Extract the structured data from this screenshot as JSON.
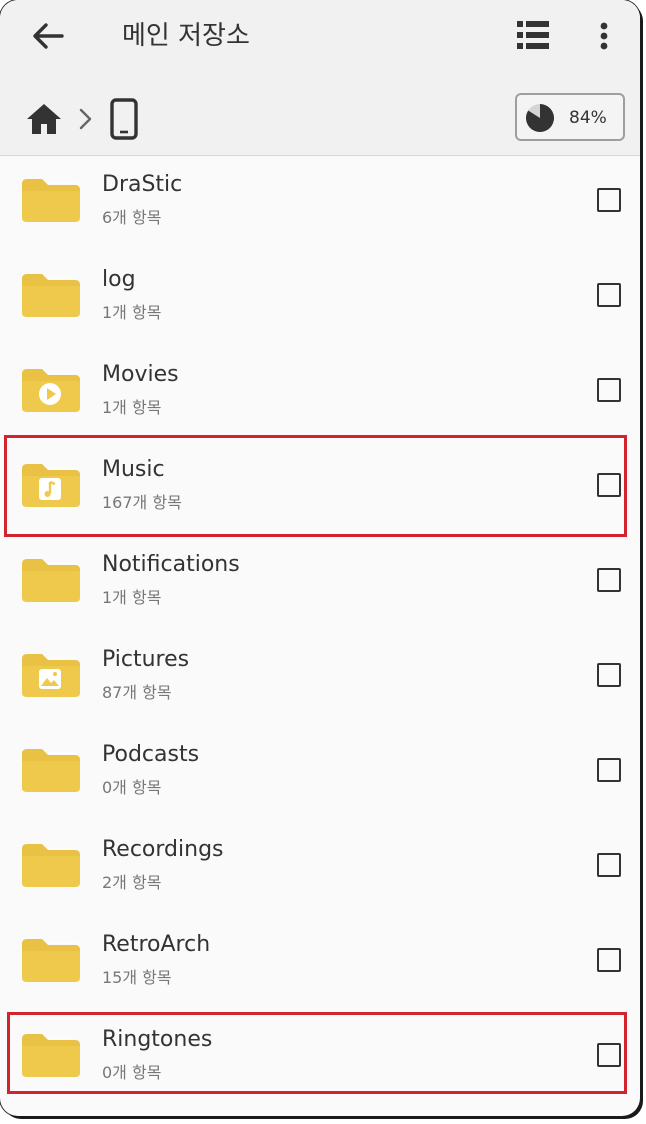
{
  "header": {
    "title": "메인 저장소",
    "back_icon": "arrow-left-icon",
    "view_icon": "list-view-icon",
    "more_icon": "more-vert-icon"
  },
  "breadcrumb": {
    "home_icon": "home-icon",
    "separator_icon": "chevron-right-icon",
    "device_icon": "phone-icon"
  },
  "storage": {
    "used_percent_label": "84%",
    "used_fraction": 0.84
  },
  "colors": {
    "folder": "#efc94c",
    "highlight": "#d3232c"
  },
  "folders": [
    {
      "name": "DraStic",
      "count": "6개 항목",
      "icon": "folder-icon"
    },
    {
      "name": "log",
      "count": "1개 항목",
      "icon": "folder-icon"
    },
    {
      "name": "Movies",
      "count": "1개 항목",
      "icon": "folder-video-icon"
    },
    {
      "name": "Music",
      "count": "167개 항목",
      "icon": "folder-music-icon"
    },
    {
      "name": "Notifications",
      "count": "1개 항목",
      "icon": "folder-icon"
    },
    {
      "name": "Pictures",
      "count": "87개 항목",
      "icon": "folder-image-icon"
    },
    {
      "name": "Podcasts",
      "count": "0개 항목",
      "icon": "folder-icon"
    },
    {
      "name": "Recordings",
      "count": "2개 항목",
      "icon": "folder-icon"
    },
    {
      "name": "RetroArch",
      "count": "15개 항목",
      "icon": "folder-icon"
    },
    {
      "name": "Ringtones",
      "count": "0개 항목",
      "icon": "folder-icon"
    }
  ]
}
